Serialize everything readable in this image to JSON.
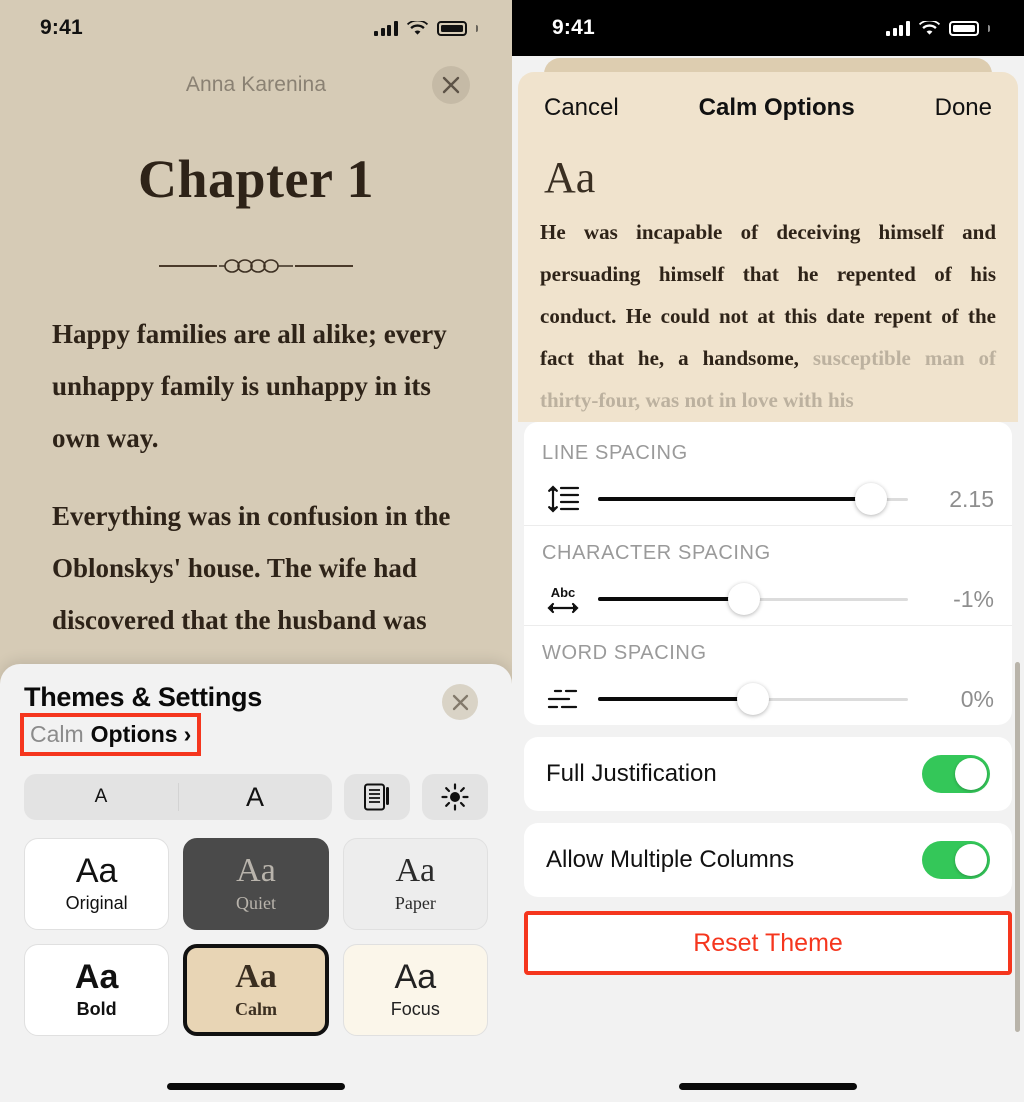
{
  "left_screen": {
    "status_bar": {
      "time": "9:41",
      "signal_icon": "cellular-bars-icon",
      "wifi_icon": "wifi-icon",
      "battery_icon": "battery-icon"
    },
    "reader": {
      "book_title": "Anna Karenina",
      "close_icon": "close-icon",
      "chapter_heading": "Chapter 1",
      "ornament_icon": "ornamental-divider-icon",
      "paragraphs": [
        "Happy families are all alike; every unhappy family is unhappy in its own way.",
        "Everything was in confusion in the Oblonskys' house. The wife had discovered that the husband was"
      ]
    },
    "themes_sheet": {
      "title": "Themes & Settings",
      "close_icon": "close-icon",
      "subtitle_theme": "Calm",
      "subtitle_action": "Options",
      "subtitle_chevron": "›",
      "highlight_color": "#f5361e",
      "controls": {
        "font_smaller_label": "A",
        "font_larger_label": "A",
        "layout_icon": "page-layout-icon",
        "brightness_icon": "brightness-sun-icon"
      },
      "themes": [
        {
          "sample": "Aa",
          "name": "Original",
          "selected": false
        },
        {
          "sample": "Aa",
          "name": "Quiet",
          "selected": false
        },
        {
          "sample": "Aa",
          "name": "Paper",
          "selected": false
        },
        {
          "sample": "Aa",
          "name": "Bold",
          "selected": false
        },
        {
          "sample": "Aa",
          "name": "Calm",
          "selected": true
        },
        {
          "sample": "Aa",
          "name": "Focus",
          "selected": false
        }
      ]
    },
    "home_indicator": "home-indicator"
  },
  "right_screen": {
    "status_bar": {
      "time": "9:41",
      "signal_icon": "cellular-bars-icon",
      "wifi_icon": "wifi-icon",
      "battery_icon": "battery-icon"
    },
    "sheet_nav": {
      "cancel_label": "Cancel",
      "title": "Calm Options",
      "done_label": "Done"
    },
    "preview": {
      "sample_label": "Aa",
      "text": "He was incapable of deceiving himself and persuading himself that he repented of his conduct. He could not at this date repent of the fact that he, a handsome,",
      "faded_text": " susceptible man of thirty-four, was not in love with his"
    },
    "sliders": [
      {
        "label": "LINE SPACING",
        "icon": "line-spacing-icon",
        "value": "2.15",
        "percent": 88
      },
      {
        "label": "CHARACTER SPACING",
        "icon": "character-spacing-icon",
        "value": "-1%",
        "percent": 47
      },
      {
        "label": "WORD SPACING",
        "icon": "word-spacing-icon",
        "value": "0%",
        "percent": 50
      }
    ],
    "toggles": [
      {
        "label": "Full Justification",
        "on": true
      },
      {
        "label": "Allow Multiple Columns",
        "on": true
      }
    ],
    "reset_button": {
      "label": "Reset Theme",
      "color": "#f5361e"
    },
    "home_indicator": "home-indicator"
  }
}
